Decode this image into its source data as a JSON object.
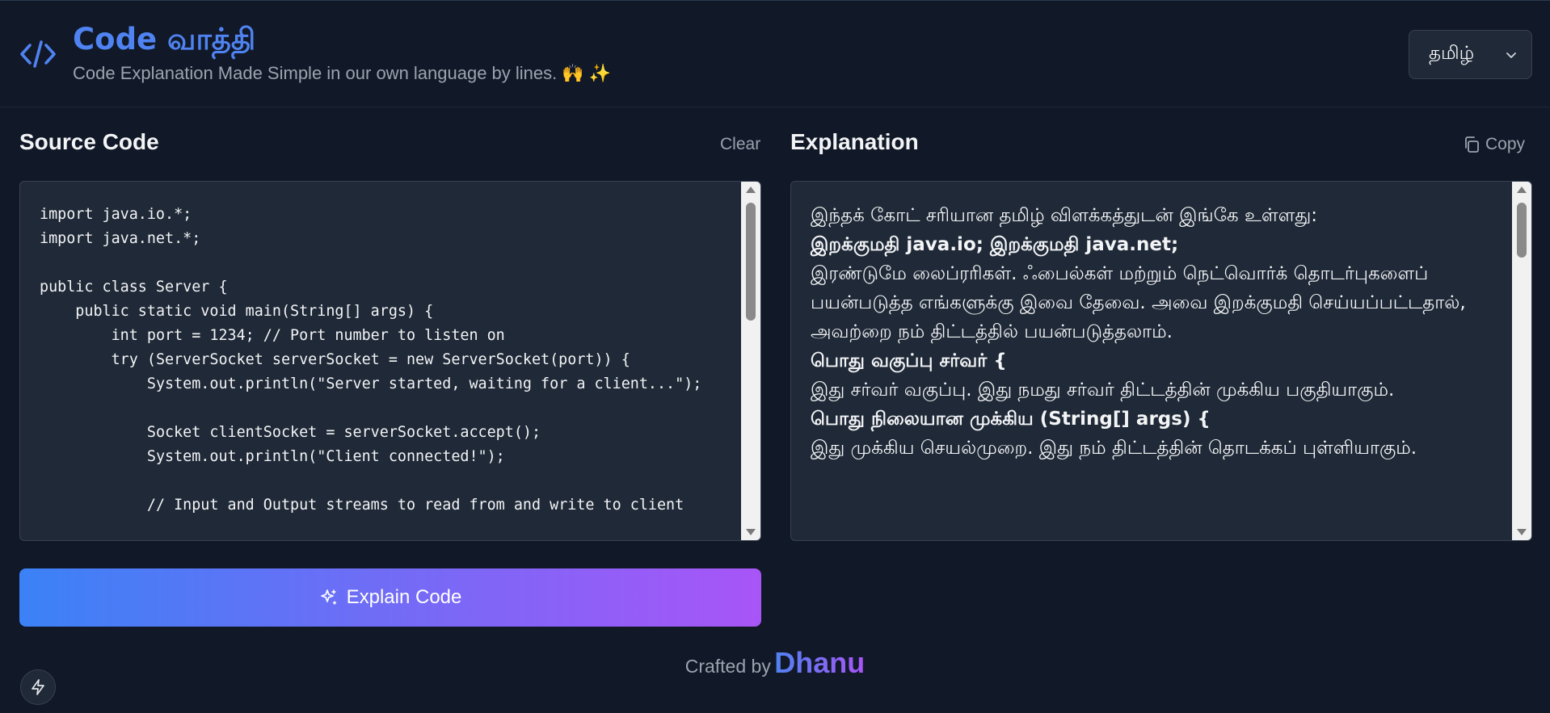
{
  "header": {
    "title": "Code வாத்தி",
    "subtitle": "Code Explanation Made Simple in our own language by lines. 🙌 ✨",
    "language": "தமிழ்"
  },
  "source": {
    "title": "Source Code",
    "clear_label": "Clear",
    "code": "import java.io.*;\nimport java.net.*;\n\npublic class Server {\n    public static void main(String[] args) {\n        int port = 1234; // Port number to listen on\n        try (ServerSocket serverSocket = new ServerSocket(port)) {\n            System.out.println(\"Server started, waiting for a client...\");\n\n            Socket clientSocket = serverSocket.accept();\n            System.out.println(\"Client connected!\");\n\n            // Input and Output streams to read from and write to client",
    "scroll_fraction": 0.0
  },
  "explanation": {
    "title": "Explanation",
    "copy_label": "Copy",
    "lines": [
      {
        "text": "இந்தக் கோட் சரியான தமிழ் விளக்கத்துடன் இங்கே உள்ளது:",
        "bold": false
      },
      {
        "text": "இறக்குமதி java.io; இறக்குமதி java.net;",
        "bold": true
      },
      {
        "text": "இரண்டுமே லைப்ரரிகள். ஃபைல்கள் மற்றும் நெட்வொர்க் தொடர்புகளைப் பயன்படுத்த எங்களுக்கு இவை தேவை. அவை இறக்குமதி செய்யப்பட்டதால், அவற்றை நம் திட்டத்தில் பயன்படுத்தலாம்.",
        "bold": false
      },
      {
        "text": "பொது வகுப்பு சர்வர் {",
        "bold": true
      },
      {
        "text": "இது சர்வர் வகுப்பு. இது நமது சர்வர் திட்டத்தின் முக்கிய பகுதியாகும்.",
        "bold": false
      },
      {
        "text": "பொது நிலையான முக்கிய (String[] args) {",
        "bold": true
      },
      {
        "text": "இது முக்கிய செயல்முறை. இது நம் திட்டத்தின் தொடக்கப் புள்ளியாகும்.",
        "bold": false
      }
    ],
    "scroll_fraction": 0.0
  },
  "actions": {
    "explain_label": "Explain Code"
  },
  "footer": {
    "crafted_by": "Crafted by",
    "author": "Dhanu"
  },
  "icons": {
    "logo": "code-brackets-icon",
    "chevron": "chevron-down-icon",
    "copy": "copy-icon",
    "explain": "sparkles-icon",
    "bolt": "lightning-bolt-icon"
  },
  "colors": {
    "background": "#111827",
    "panel": "#1f2937",
    "accent_blue": "#4f83f1",
    "accent_purple": "#a855f7"
  }
}
